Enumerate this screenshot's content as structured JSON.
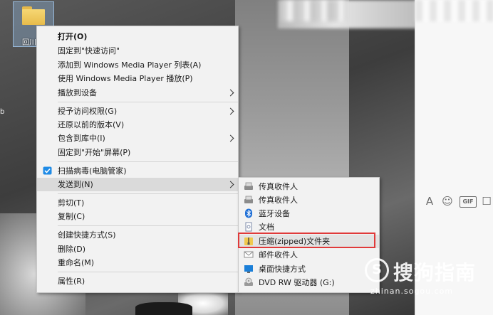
{
  "desktop": {
    "folder_label": "回川",
    "edge_mark": "b"
  },
  "chat_toolbar": {
    "a_label": "A",
    "emoji_icon": "☺",
    "gif_label": "GIF",
    "more_icon": "☐"
  },
  "context_menu": {
    "items": [
      {
        "label": "打开(O)"
      },
      {
        "label": "固定到\"快速访问\""
      },
      {
        "label": "添加到 Windows Media Player 列表(A)"
      },
      {
        "label": "使用 Windows Media Player 播放(P)"
      },
      {
        "label": "播放到设备"
      },
      {
        "label": "授予访问权限(G)"
      },
      {
        "label": "还原以前的版本(V)"
      },
      {
        "label": "包含到库中(I)"
      },
      {
        "label": "固定到\"开始\"屏幕(P)"
      },
      {
        "label": "扫描病毒(电脑管家)"
      },
      {
        "label": "发送到(N)"
      },
      {
        "label": "剪切(T)"
      },
      {
        "label": "复制(C)"
      },
      {
        "label": "创建快捷方式(S)"
      },
      {
        "label": "删除(D)"
      },
      {
        "label": "重命名(M)"
      },
      {
        "label": "属性(R)"
      }
    ]
  },
  "send_to_menu": {
    "items": [
      {
        "label": "传真收件人",
        "icon": "fax-icon"
      },
      {
        "label": "传真收件人",
        "icon": "fax-icon"
      },
      {
        "label": "蓝牙设备",
        "icon": "bluetooth-icon"
      },
      {
        "label": "文档",
        "icon": "document-icon"
      },
      {
        "label": "压缩(zipped)文件夹",
        "icon": "zip-folder-icon"
      },
      {
        "label": "邮件收件人",
        "icon": "mail-icon"
      },
      {
        "label": "桌面快捷方式",
        "icon": "desktop-icon"
      },
      {
        "label": "DVD RW 驱动器 (G:)",
        "icon": "dvd-drive-icon"
      }
    ]
  },
  "watermark": {
    "logo_letter": "S",
    "brand": "搜狗指南",
    "url": "zhinan.sogou.com"
  },
  "colors": {
    "highlight_box": "#e03a3a",
    "menu_bg": "#f2f2f2"
  }
}
